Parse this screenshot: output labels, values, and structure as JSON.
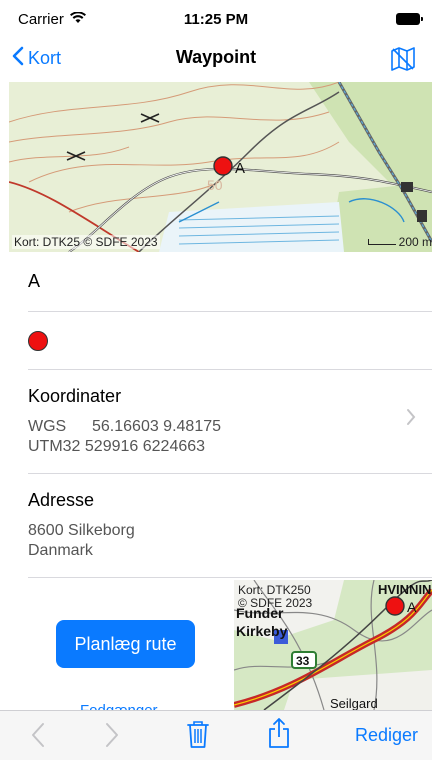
{
  "status": {
    "carrier": "Carrier",
    "time": "11:25 PM"
  },
  "nav": {
    "back_label": "Kort",
    "title": "Waypoint"
  },
  "top_map": {
    "credit": "Kort: DTK25 © SDFE 2023",
    "scale": "200 m",
    "marker_label": "A",
    "contour_label": "50"
  },
  "waypoint": {
    "name": "A"
  },
  "coordinates": {
    "heading": "Koordinater",
    "wgs_label": "WGS",
    "wgs_value": "56.16603  9.48175",
    "utm_label": "UTM32",
    "utm_value": "529916  6224663"
  },
  "address": {
    "heading": "Adresse",
    "line1": "8600 Silkeborg",
    "line2": "Danmark"
  },
  "actions": {
    "plan_route": "Planlæg rute",
    "follow": "Fodgænger"
  },
  "bottom_map": {
    "credit_line1": "Kort: DTK250",
    "credit_line2": "© SDFE 2023",
    "place1": "Funder",
    "place2": "Kirkeby",
    "place3": "HVINNIN",
    "place4": "Seilgard",
    "road_number": "33",
    "marker_label": "A"
  },
  "toolbar": {
    "edit_label": "Rediger"
  },
  "colors": {
    "accent": "#0a7aff",
    "marker": "#e11111"
  },
  "icons": [
    "wifi-icon",
    "battery-icon",
    "chevron-left-icon",
    "map-toggle-icon",
    "chevron-right-icon",
    "trash-icon",
    "share-icon"
  ]
}
